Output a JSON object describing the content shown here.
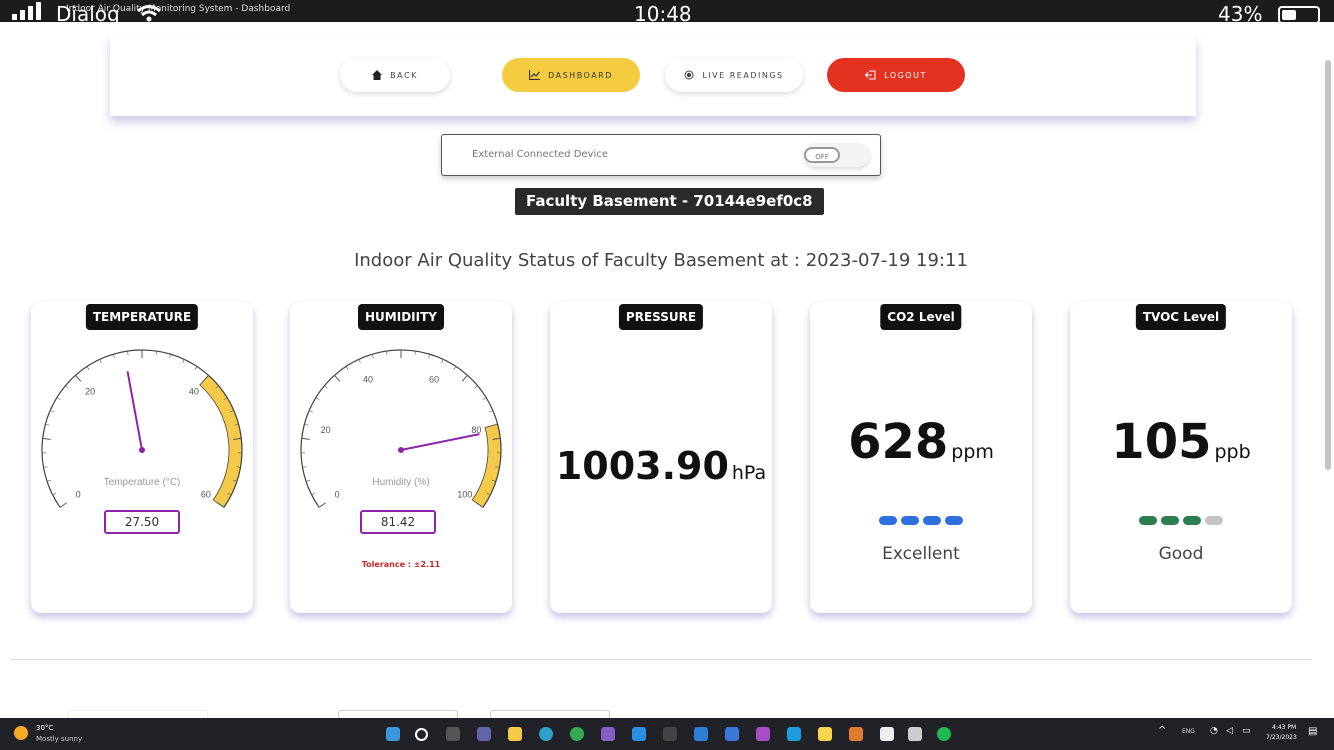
{
  "status_bar": {
    "carrier": "Dialog",
    "time": "10:48",
    "battery": "43%",
    "window_title": "Indoor Air Quality Monitoring System - Dashboard"
  },
  "nav": {
    "back": "BACK",
    "dashboard": "DASHBOARD",
    "live_readings": "LIVE READINGS",
    "logout": "LOGOUT"
  },
  "device": {
    "label": "External Connected Device",
    "toggle_state": "OFF",
    "name_id": "Faculty Basement - 70144e9ef0c8"
  },
  "status_heading": "Indoor Air Quality Status of Faculty Basement at : 2023-07-19 19:11",
  "sensors": {
    "temperature": {
      "title": "TEMPERATURE",
      "gauge_label": "Temperature (°C)",
      "value_text": "27.50",
      "value": 27.5,
      "min": 0,
      "max": 60,
      "ticks": [
        "0",
        "20",
        "40",
        "60"
      ],
      "highlight_from": 40,
      "highlight_to": 60
    },
    "humidity": {
      "title": "HUMIDIITY",
      "gauge_label": "Humidity (%)",
      "value_text": "81.42",
      "value": 81.42,
      "min": 0,
      "max": 100,
      "ticks": [
        "0",
        "20",
        "40",
        "60",
        "80",
        "100"
      ],
      "highlight_from": 80,
      "highlight_to": 100,
      "tolerance": "Tolerance : ±2.11"
    },
    "pressure": {
      "title": "PRESSURE",
      "value": "1003.90",
      "unit": "hPa"
    },
    "co2": {
      "title": "CO2 Level",
      "value": "628",
      "unit": "ppm",
      "quality": "Excellent",
      "level": 4,
      "levels_total": 4,
      "color": "#2f6fe0"
    },
    "tvoc": {
      "title": "TVOC Level",
      "value": "105",
      "unit": "ppb",
      "quality": "Good",
      "level": 3,
      "levels_total": 4,
      "color": "#2e7d4f"
    }
  },
  "colors": {
    "dashboard_button": "#f5cc3f",
    "logout_button": "#e43220",
    "gauge_highlight": "#f5c94a",
    "gauge_needle": "#8e24aa",
    "dot_inactive": "#c4c4c4"
  },
  "taskbar": {
    "weather_temp": "30°C",
    "weather_desc": "Mostly sunny",
    "language": "ENG",
    "clock_time": "4:43 PM",
    "clock_date": "7/23/2023"
  }
}
